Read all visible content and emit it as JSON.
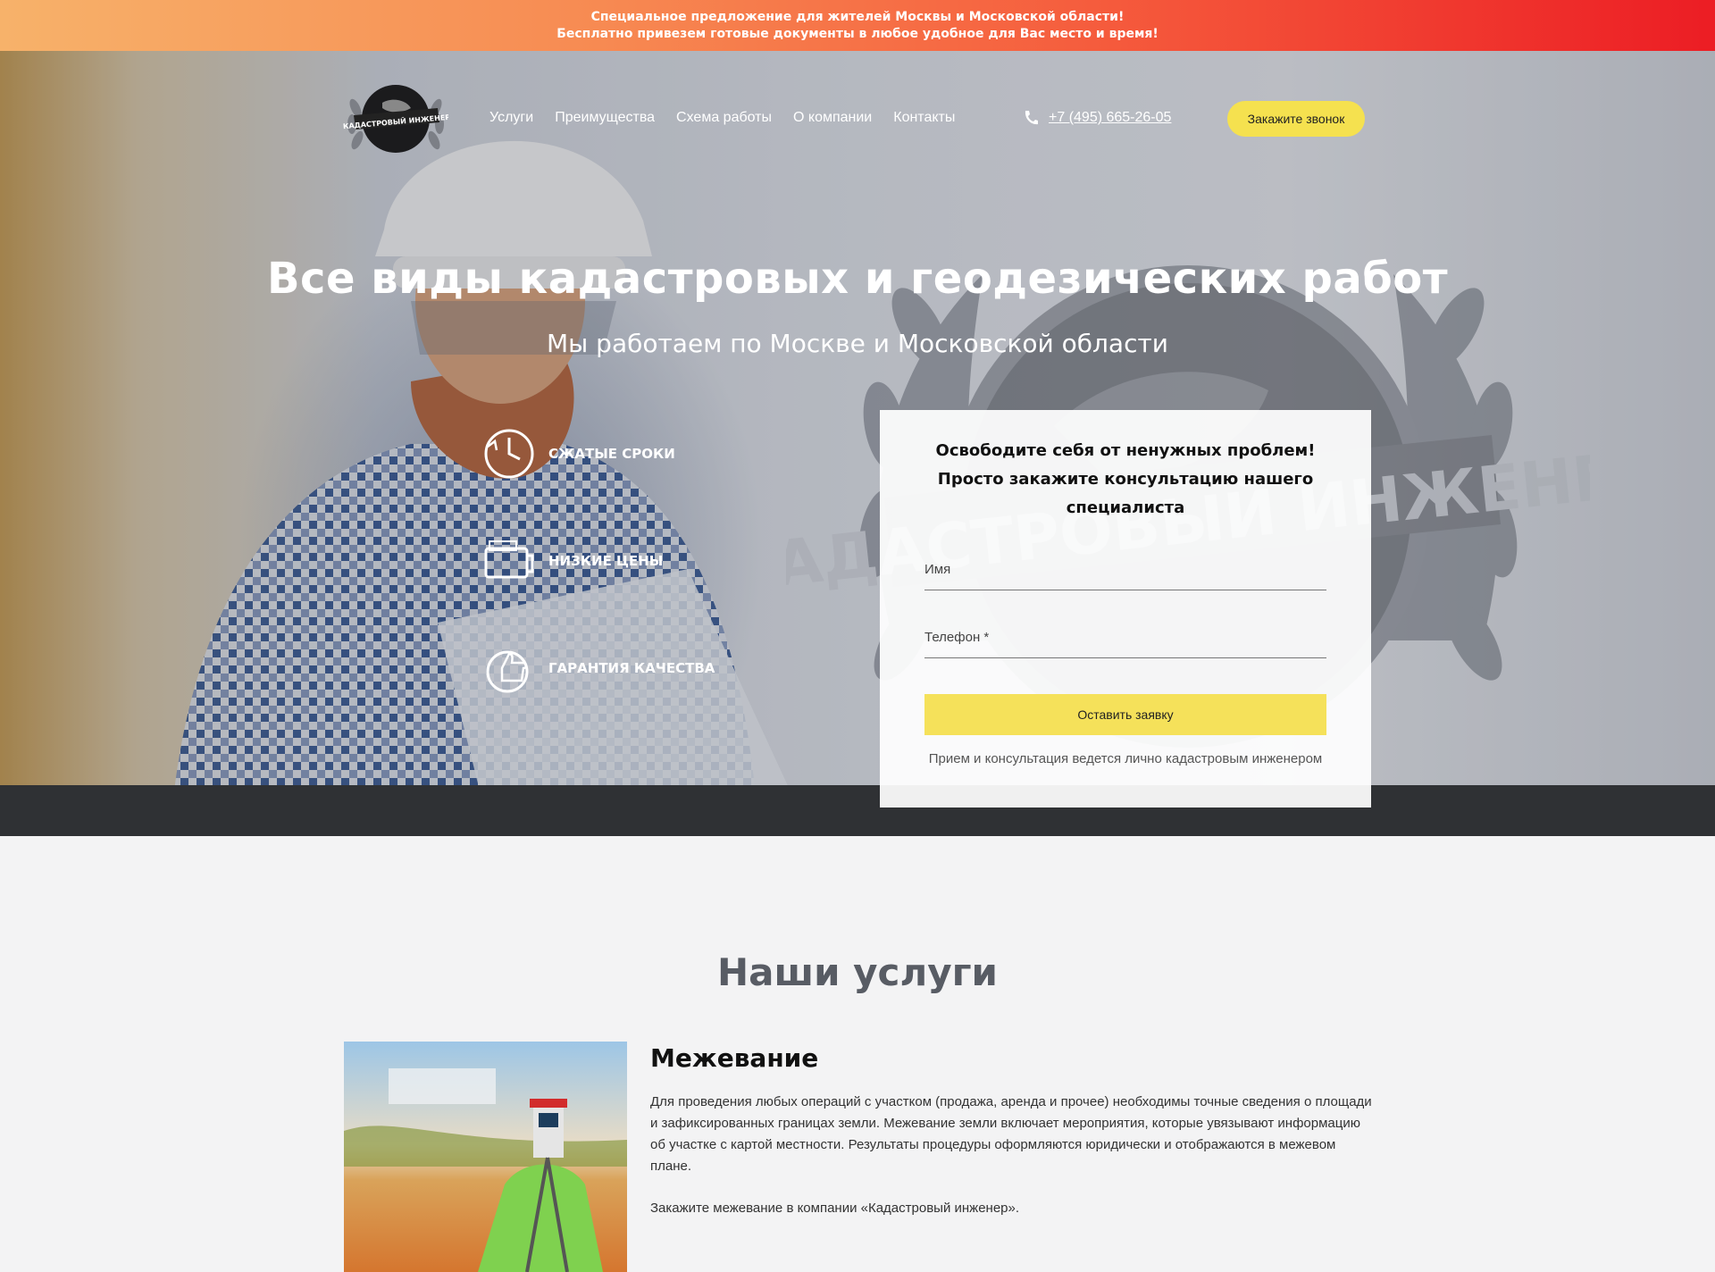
{
  "promo": {
    "line1": "Специальное предложение для жителей Москвы и Московской области!",
    "line2": "Бесплатно привезем готовые документы в любое удобное для Вас место и время!"
  },
  "header": {
    "logo_text": "КАДАСТРОВЫЙ ИНЖЕНЕР",
    "nav": [
      "Услуги",
      "Преимущества",
      "Схема работы",
      "О компании",
      "Контакты"
    ],
    "phone": "+7 (495) 665-26-05",
    "callback_label": "Закажите звонок"
  },
  "hero": {
    "title": "Все виды кадастровых и геодезических работ",
    "subtitle": "Мы работаем по Москве и Московской области",
    "emblem_text": "КАДАСТРОВЫЙ ИНЖЕНЕР",
    "features": [
      "СЖАТЫЕ СРОКИ",
      "НИЗКИЕ ЦЕНЫ",
      "ГАРАНТИЯ КАЧЕСТВА"
    ]
  },
  "form": {
    "title_lines": [
      "Освободите себя от ненужных проблем!",
      "Просто закажите консультацию нашего",
      "специалиста"
    ],
    "name_placeholder": "Имя",
    "phone_placeholder": "Телефон *",
    "submit_label": "Оставить заявку",
    "note": "Прием и консультация ведется лично кадастровым инженером"
  },
  "services": {
    "title": "Наши услуги",
    "items": [
      {
        "name": "Межевание",
        "description": "Для проведения любых операций с участком (продажа, аренда и прочее) необходимы точные сведения о площади и зафиксированных границах земли. Межевание земли включает мероприятия, которые увязывают информацию об участке с картой местности. Результаты процедуры оформляются юридически и отображаются в межевом плане.",
        "cta": "Закажите межевание в компании «Кадастровый инженер»."
      }
    ]
  },
  "colors": {
    "accent_yellow": "#f5e14f",
    "promo_start": "#f7b26a",
    "promo_end": "#ec1d24",
    "dark_band": "#2f3134",
    "section_title": "#585c64"
  }
}
